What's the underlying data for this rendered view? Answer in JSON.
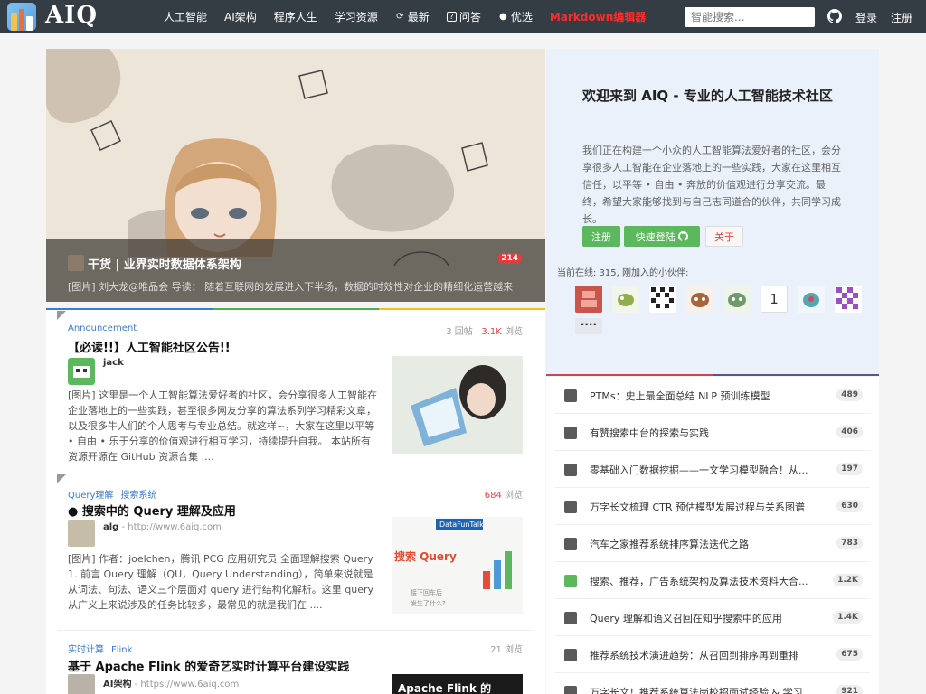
{
  "nav": {
    "logo_text": "AIQ",
    "links": [
      {
        "label": "人工智能",
        "icon": ""
      },
      {
        "label": "AI架构",
        "icon": ""
      },
      {
        "label": "程序人生",
        "icon": ""
      },
      {
        "label": "学习资源",
        "icon": ""
      },
      {
        "label": "最新",
        "icon": "refresh-icon"
      },
      {
        "label": "问答",
        "icon": "question-icon"
      },
      {
        "label": "优选",
        "icon": "user-icon"
      },
      {
        "label": "Markdown编辑器",
        "icon": ""
      }
    ],
    "search_placeholder": "智能搜索...",
    "login": "登录",
    "register": "注册"
  },
  "hero": {
    "title": "干货 | 业界实时数据体系架构",
    "badge": "214",
    "subtitle": "[图片] 刘大龙@唯品会 导读：  随着互联网的发展进入下半场，数据的时效性对企业的精细化运营越来"
  },
  "welcome": {
    "title": "欢迎来到 AIQ - 专业的人工智能技术社区",
    "desc": "我们正在构建一个小众的人工智能算法爱好者的社区，会分享很多人工智能在企业落地上的一些实践，大家在这里相互信任，以平等 • 自由 • 奔放的价值观进行分享交流。最终，希望大家能够找到与自己志同道合的伙伴，共同学习成长。",
    "btn_register": "注册",
    "btn_quick_login": "快速登陆",
    "btn_about": "关于",
    "online": "当前在线: 315,   刚加入的小伙伴:",
    "member_number_avatar": "1",
    "more": "····"
  },
  "posts": [
    {
      "tags": [
        "Announcement"
      ],
      "replies": "3 回帖",
      "views": "3.1K",
      "views_label": " 浏览",
      "title": "【必读!!】人工智能社区公告!!",
      "author": "jack",
      "url": "",
      "excerpt": "[图片]       这里是一个人工智能算法爱好者的社区，会分享很多人工智能在企业落地上的一些实践，甚至很多网友分享的算法系列学习精彩文章，以及很多牛人们的个人思考与专业总结。就这样~，大家在这里以平等 • 自由 • 乐于分享的价值观进行相互学习，持续提升自我。 本站所有资源开源在 GitHub 资源合集 ...."
    },
    {
      "tags": [
        "Query理解",
        "搜索系统"
      ],
      "replies": "",
      "views": "684",
      "views_label": " 浏览",
      "title": "搜索中的 Query 理解及应用",
      "author": "alg",
      "url": " - http://www.6aiq.com",
      "excerpt": "[图片] 作者：joelchen，腾讯 PCG 应用研究员 全面理解搜索 Query 1. 前言 Query 理解（QU，Query Understanding），简单来说就是从词法、句法、语义三个层面对 query 进行结构化解析。这里 query 从广义上来说涉及的任务比较多，最常见的就是我们在 ...."
    },
    {
      "tags": [
        "实时计算",
        "Flink"
      ],
      "replies": "",
      "views": "21",
      "views_label": " 浏览",
      "title": "基于 Apache Flink 的爱奇艺实时计算平台建设实践",
      "author": "AI架构",
      "url": " - https://www.6aiq.com",
      "excerpt": ""
    }
  ],
  "thumb_text": {
    "query_brand": "DataFunTalk",
    "query_title": "搜索 Query",
    "query_sub1": "接下回车后",
    "query_sub2": "发生了什么?",
    "flink_title": "Apache Flink 的"
  },
  "hot": [
    {
      "title": "PTMs：史上最全面总结 NLP 预训练模型",
      "count": "489"
    },
    {
      "title": "有赞搜索中台的探索与实践",
      "count": "406"
    },
    {
      "title": "零基础入门数据挖掘——一文学习模型融合！从...",
      "count": "197"
    },
    {
      "title": "万字长文梳理 CTR 预估模型发展过程与关系图谱",
      "count": "630"
    },
    {
      "title": "汽车之家推荐系统排序算法迭代之路",
      "count": "783"
    },
    {
      "title": "搜索、推荐，广告系统架构及算法技术资料大合...",
      "count": "1.2K"
    },
    {
      "title": "Query 理解和语义召回在知乎搜索中的应用",
      "count": "1.4K"
    },
    {
      "title": "推荐系统技术演进趋势：从召回到排序再到重排",
      "count": "675"
    },
    {
      "title": "万字长文！推荐系统算法岗校招面试经验 & 学习...",
      "count": "921"
    }
  ]
}
